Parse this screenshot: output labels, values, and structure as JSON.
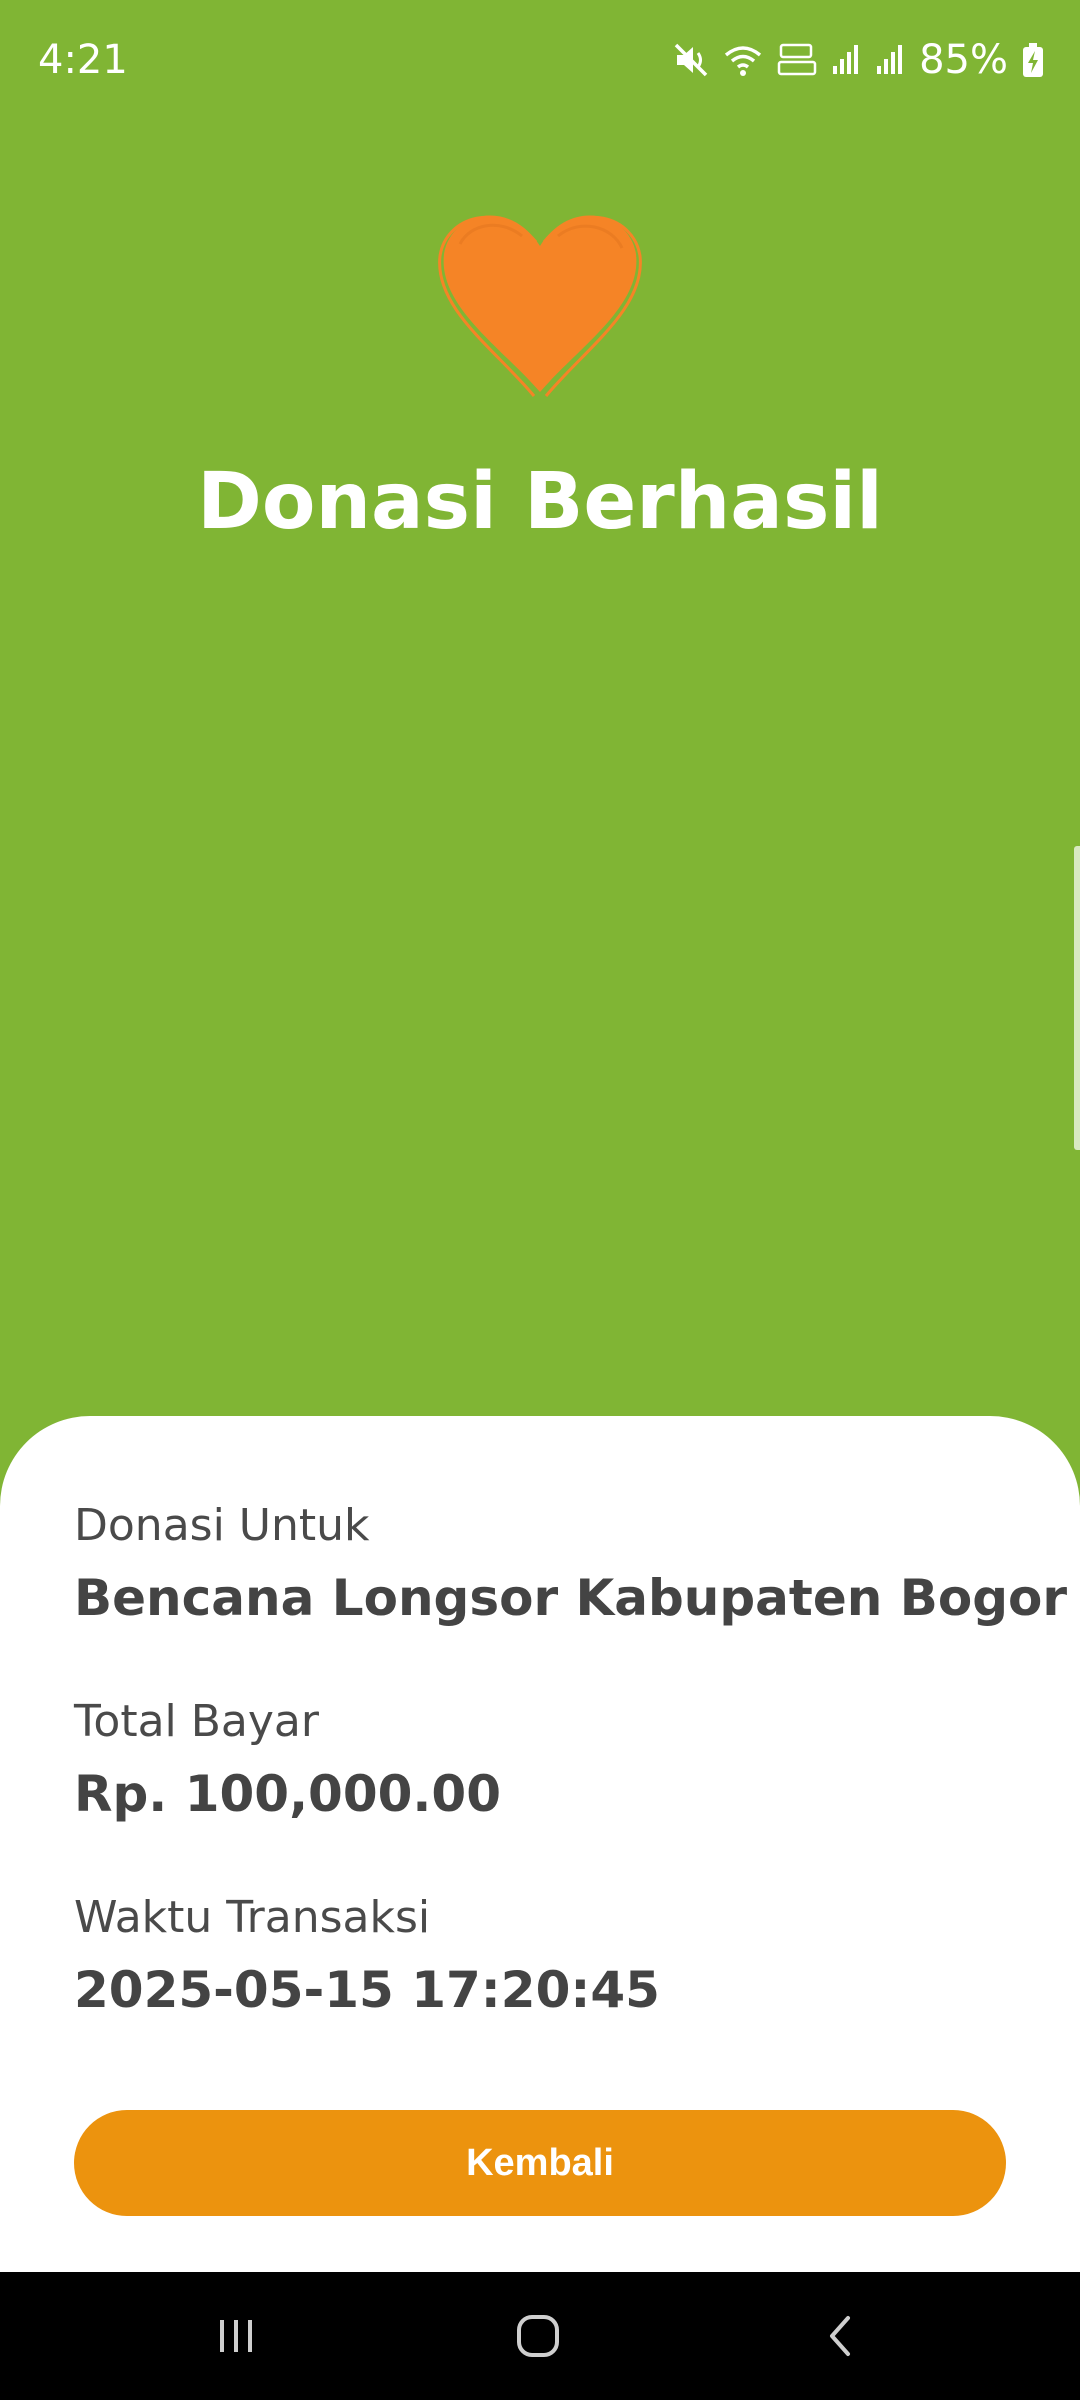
{
  "status_bar": {
    "time": "4:21",
    "battery": "85%",
    "icons": [
      "mute-icon",
      "wifi-icon",
      "volte-icon",
      "signal-icon",
      "signal-icon",
      "battery-charging-icon"
    ]
  },
  "header": {
    "icon": "heart-icon",
    "title": "Donasi Berhasil"
  },
  "details": {
    "donation_for_label": "Donasi Untuk",
    "donation_for_value": "Bencana Longsor Kabupaten Bogor",
    "total_label": "Total Bayar",
    "total_value": "Rp. 100,000.00",
    "time_label": "Waktu Transaksi",
    "time_value": "2025-05-15 17:20:45"
  },
  "actions": {
    "back_label": "Kembali"
  },
  "colors": {
    "background": "#80B534",
    "heart": "#F58426",
    "button": "#EC930E",
    "sheet": "#FFFFFF"
  },
  "nav_bar": {
    "buttons": [
      "recent-apps-icon",
      "home-icon",
      "back-icon"
    ]
  }
}
